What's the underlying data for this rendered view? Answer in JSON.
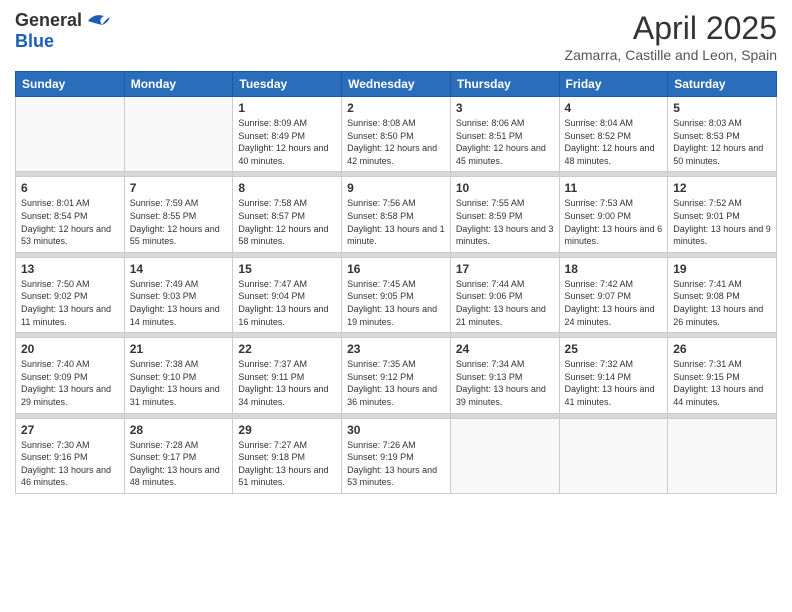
{
  "header": {
    "logo_general": "General",
    "logo_blue": "Blue",
    "month_title": "April 2025",
    "subtitle": "Zamarra, Castille and Leon, Spain"
  },
  "days_of_week": [
    "Sunday",
    "Monday",
    "Tuesday",
    "Wednesday",
    "Thursday",
    "Friday",
    "Saturday"
  ],
  "weeks": [
    [
      {
        "day": "",
        "info": ""
      },
      {
        "day": "",
        "info": ""
      },
      {
        "day": "1",
        "info": "Sunrise: 8:09 AM\nSunset: 8:49 PM\nDaylight: 12 hours and 40 minutes."
      },
      {
        "day": "2",
        "info": "Sunrise: 8:08 AM\nSunset: 8:50 PM\nDaylight: 12 hours and 42 minutes."
      },
      {
        "day": "3",
        "info": "Sunrise: 8:06 AM\nSunset: 8:51 PM\nDaylight: 12 hours and 45 minutes."
      },
      {
        "day": "4",
        "info": "Sunrise: 8:04 AM\nSunset: 8:52 PM\nDaylight: 12 hours and 48 minutes."
      },
      {
        "day": "5",
        "info": "Sunrise: 8:03 AM\nSunset: 8:53 PM\nDaylight: 12 hours and 50 minutes."
      }
    ],
    [
      {
        "day": "6",
        "info": "Sunrise: 8:01 AM\nSunset: 8:54 PM\nDaylight: 12 hours and 53 minutes."
      },
      {
        "day": "7",
        "info": "Sunrise: 7:59 AM\nSunset: 8:55 PM\nDaylight: 12 hours and 55 minutes."
      },
      {
        "day": "8",
        "info": "Sunrise: 7:58 AM\nSunset: 8:57 PM\nDaylight: 12 hours and 58 minutes."
      },
      {
        "day": "9",
        "info": "Sunrise: 7:56 AM\nSunset: 8:58 PM\nDaylight: 13 hours and 1 minute."
      },
      {
        "day": "10",
        "info": "Sunrise: 7:55 AM\nSunset: 8:59 PM\nDaylight: 13 hours and 3 minutes."
      },
      {
        "day": "11",
        "info": "Sunrise: 7:53 AM\nSunset: 9:00 PM\nDaylight: 13 hours and 6 minutes."
      },
      {
        "day": "12",
        "info": "Sunrise: 7:52 AM\nSunset: 9:01 PM\nDaylight: 13 hours and 9 minutes."
      }
    ],
    [
      {
        "day": "13",
        "info": "Sunrise: 7:50 AM\nSunset: 9:02 PM\nDaylight: 13 hours and 11 minutes."
      },
      {
        "day": "14",
        "info": "Sunrise: 7:49 AM\nSunset: 9:03 PM\nDaylight: 13 hours and 14 minutes."
      },
      {
        "day": "15",
        "info": "Sunrise: 7:47 AM\nSunset: 9:04 PM\nDaylight: 13 hours and 16 minutes."
      },
      {
        "day": "16",
        "info": "Sunrise: 7:45 AM\nSunset: 9:05 PM\nDaylight: 13 hours and 19 minutes."
      },
      {
        "day": "17",
        "info": "Sunrise: 7:44 AM\nSunset: 9:06 PM\nDaylight: 13 hours and 21 minutes."
      },
      {
        "day": "18",
        "info": "Sunrise: 7:42 AM\nSunset: 9:07 PM\nDaylight: 13 hours and 24 minutes."
      },
      {
        "day": "19",
        "info": "Sunrise: 7:41 AM\nSunset: 9:08 PM\nDaylight: 13 hours and 26 minutes."
      }
    ],
    [
      {
        "day": "20",
        "info": "Sunrise: 7:40 AM\nSunset: 9:09 PM\nDaylight: 13 hours and 29 minutes."
      },
      {
        "day": "21",
        "info": "Sunrise: 7:38 AM\nSunset: 9:10 PM\nDaylight: 13 hours and 31 minutes."
      },
      {
        "day": "22",
        "info": "Sunrise: 7:37 AM\nSunset: 9:11 PM\nDaylight: 13 hours and 34 minutes."
      },
      {
        "day": "23",
        "info": "Sunrise: 7:35 AM\nSunset: 9:12 PM\nDaylight: 13 hours and 36 minutes."
      },
      {
        "day": "24",
        "info": "Sunrise: 7:34 AM\nSunset: 9:13 PM\nDaylight: 13 hours and 39 minutes."
      },
      {
        "day": "25",
        "info": "Sunrise: 7:32 AM\nSunset: 9:14 PM\nDaylight: 13 hours and 41 minutes."
      },
      {
        "day": "26",
        "info": "Sunrise: 7:31 AM\nSunset: 9:15 PM\nDaylight: 13 hours and 44 minutes."
      }
    ],
    [
      {
        "day": "27",
        "info": "Sunrise: 7:30 AM\nSunset: 9:16 PM\nDaylight: 13 hours and 46 minutes."
      },
      {
        "day": "28",
        "info": "Sunrise: 7:28 AM\nSunset: 9:17 PM\nDaylight: 13 hours and 48 minutes."
      },
      {
        "day": "29",
        "info": "Sunrise: 7:27 AM\nSunset: 9:18 PM\nDaylight: 13 hours and 51 minutes."
      },
      {
        "day": "30",
        "info": "Sunrise: 7:26 AM\nSunset: 9:19 PM\nDaylight: 13 hours and 53 minutes."
      },
      {
        "day": "",
        "info": ""
      },
      {
        "day": "",
        "info": ""
      },
      {
        "day": "",
        "info": ""
      }
    ]
  ]
}
